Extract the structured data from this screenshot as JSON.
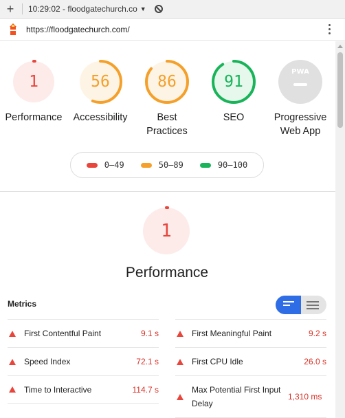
{
  "tab": {
    "title": "10:29:02 - floodgatechurch.co"
  },
  "address": {
    "url": "https://floodgatechurch.com/"
  },
  "gauges": [
    {
      "score": "1",
      "label": "Performance",
      "fraction": 0.01,
      "color": "#e8453c",
      "bg": "#fdebea"
    },
    {
      "score": "56",
      "label": "Accessibility",
      "fraction": 0.56,
      "color": "#f4a02a",
      "bg": "#fef4e6"
    },
    {
      "score": "86",
      "label": "Best Practices",
      "fraction": 0.86,
      "color": "#f4a02a",
      "bg": "#fef4e6"
    },
    {
      "score": "91",
      "label": "SEO",
      "fraction": 0.91,
      "color": "#19b45a",
      "bg": "#e6f7ec"
    },
    {
      "score": "PWA",
      "label": "Progressive Web App"
    }
  ],
  "legend": [
    {
      "range": "0–49",
      "color": "#e8453c"
    },
    {
      "range": "50–89",
      "color": "#f4a02a"
    },
    {
      "range": "90–100",
      "color": "#19b45a"
    }
  ],
  "category": {
    "score": "1",
    "title": "Performance",
    "fraction": 0.01
  },
  "metrics": {
    "heading": "Metrics",
    "left": [
      {
        "name": "First Contentful Paint",
        "value": "9.1 s"
      },
      {
        "name": "Speed Index",
        "value": "72.1 s"
      },
      {
        "name": "Time to Interactive",
        "value": "114.7 s"
      }
    ],
    "right": [
      {
        "name": "First Meaningful Paint",
        "value": "9.2 s"
      },
      {
        "name": "First CPU Idle",
        "value": "26.0 s"
      },
      {
        "name": "Max Potential First Input Delay",
        "value": "1,310 ms"
      }
    ]
  }
}
